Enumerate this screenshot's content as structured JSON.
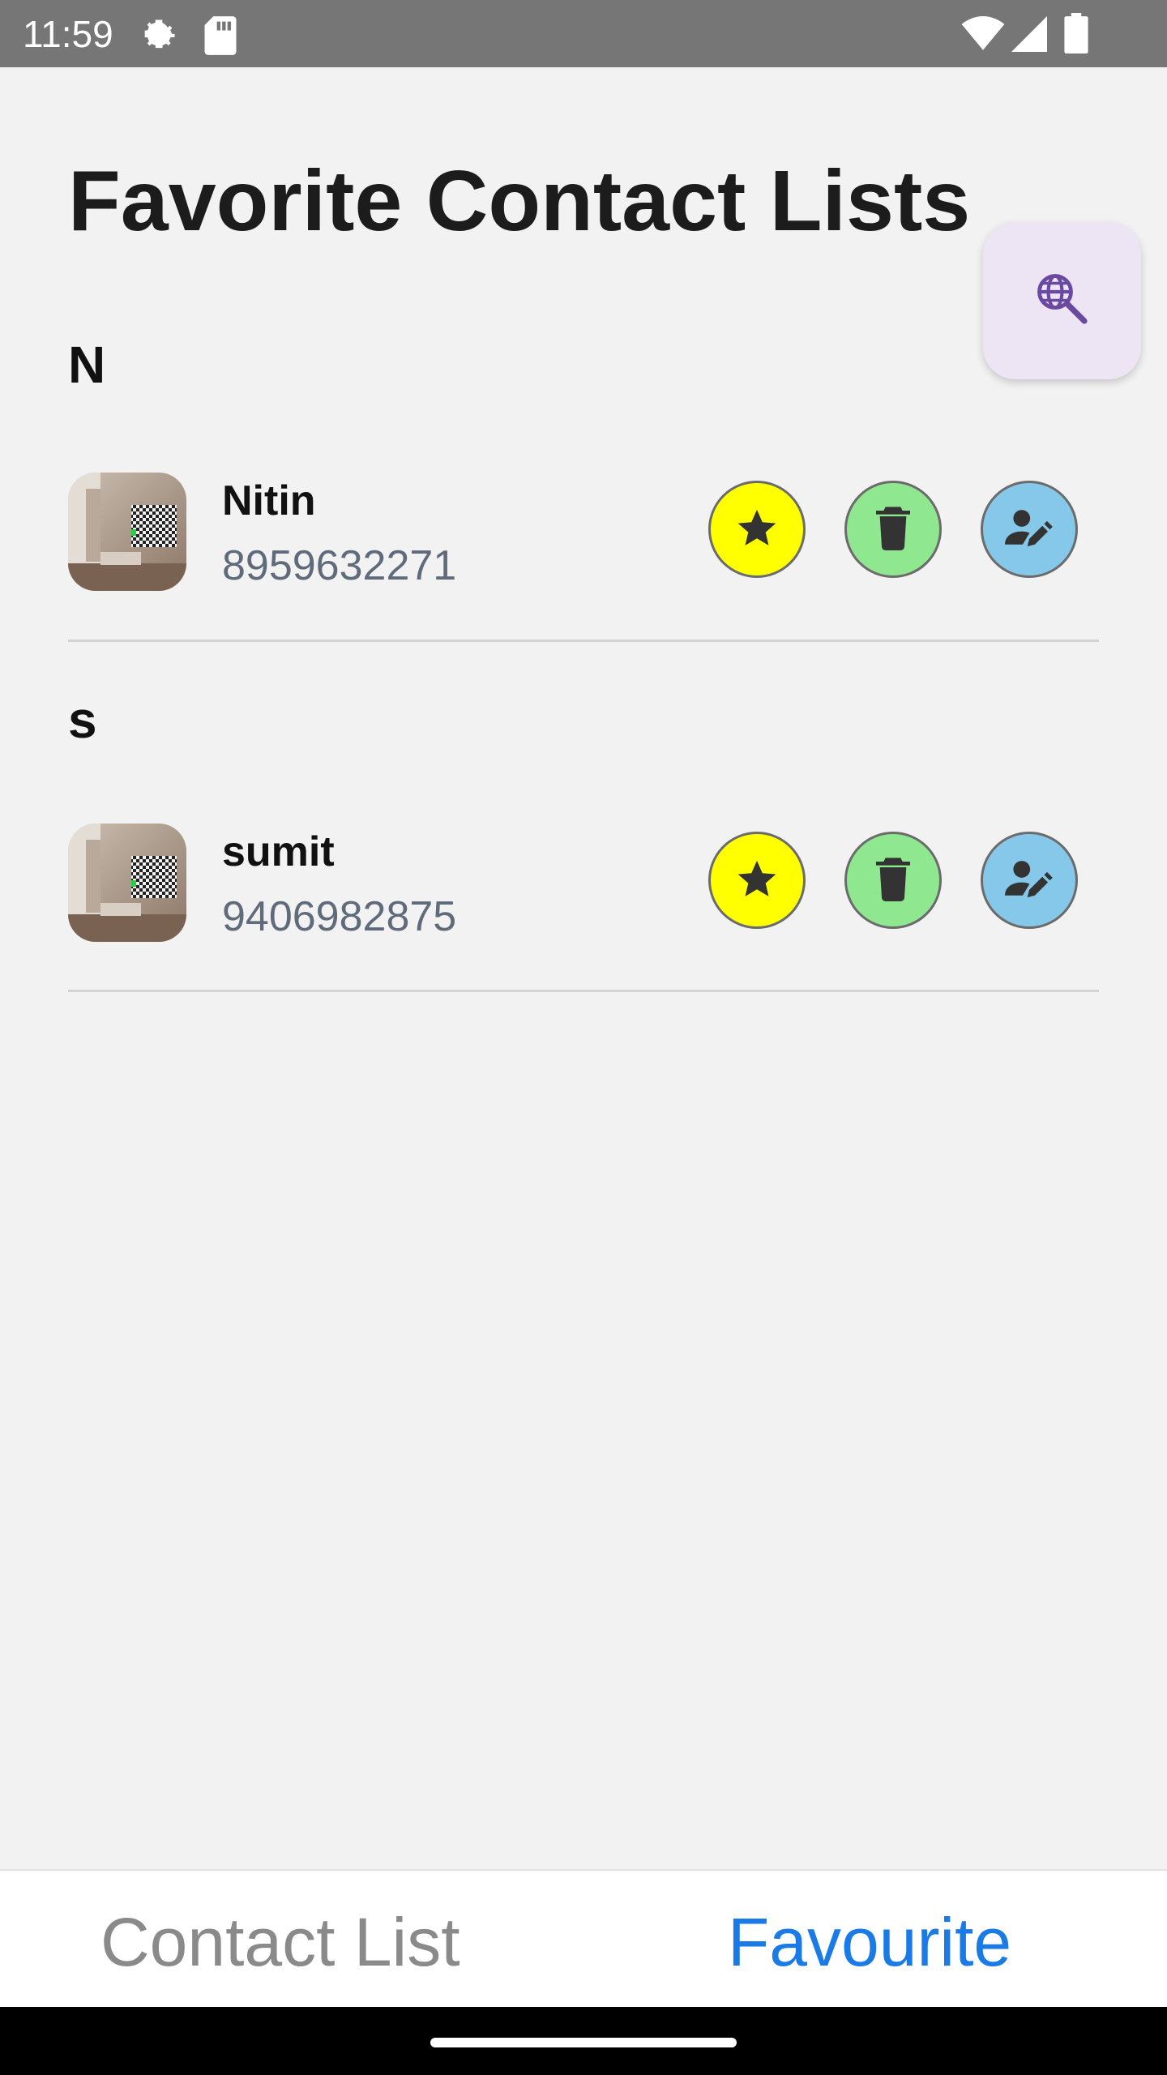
{
  "status_bar": {
    "time": "11:59",
    "icons": [
      "settings-gear-icon",
      "sd-card-icon",
      "wifi-icon",
      "signal-icon",
      "battery-icon"
    ]
  },
  "page": {
    "title": "Favorite Contact Lists",
    "search_fab_icon": "travel-explore-icon"
  },
  "sections": [
    {
      "letter": "N",
      "contacts": [
        {
          "name": "Nitin",
          "phone": "8959632271"
        }
      ]
    },
    {
      "letter": "s",
      "contacts": [
        {
          "name": "sumit",
          "phone": "9406982875"
        }
      ]
    }
  ],
  "actions": {
    "favorite_icon": "star-icon",
    "delete_icon": "trash-icon",
    "edit_icon": "edit-person-icon"
  },
  "colors": {
    "favorite_button": "#ffff00",
    "delete_button": "#8fe88f",
    "edit_button": "#86c8ea",
    "active_tab": "#1a7be6",
    "inactive_tab": "#8a8a8a",
    "fab_background": "#ede5f3"
  },
  "bottom_nav": {
    "tabs": [
      {
        "label": "Contact List",
        "active": false
      },
      {
        "label": "Favourite",
        "active": true
      }
    ]
  }
}
